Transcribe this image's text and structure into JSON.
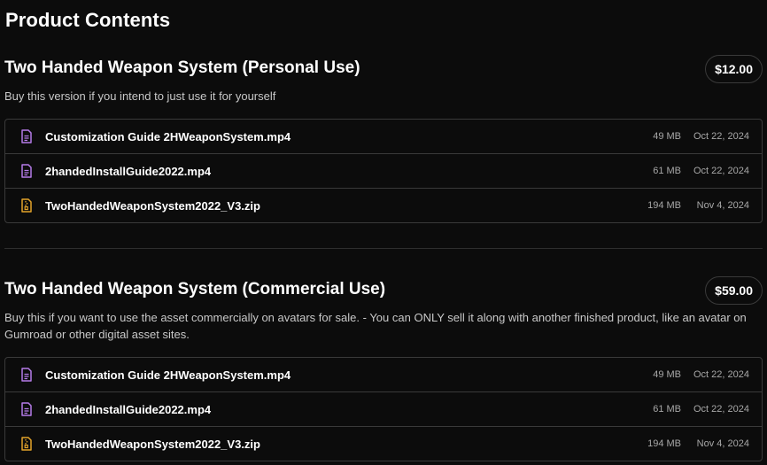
{
  "page_title": "Product Contents",
  "colors": {
    "background": "#0c0c0c",
    "border": "#3a3a3a",
    "video_icon": "#b57be8",
    "zip_icon": "#e3a32a",
    "muted_text": "#a8a8a8"
  },
  "sections": [
    {
      "title": "Two Handed Weapon System (Personal Use)",
      "price": "$12.00",
      "description": "Buy this version if you intend to just use it for yourself",
      "files": [
        {
          "name": "Customization Guide 2HWeaponSystem.mp4",
          "size": "49 MB",
          "date": "Oct 22, 2024",
          "icon": "document-icon"
        },
        {
          "name": "2handedInstallGuide2022.mp4",
          "size": "61 MB",
          "date": "Oct 22, 2024",
          "icon": "document-icon"
        },
        {
          "name": "TwoHandedWeaponSystem2022_V3.zip",
          "size": "194 MB",
          "date": "Nov 4, 2024",
          "icon": "zip-file-icon"
        }
      ]
    },
    {
      "title": "Two Handed Weapon System (Commercial Use)",
      "price": "$59.00",
      "description": "Buy this if you want to use the asset commercially on avatars for sale. - You can ONLY sell it along with another finished product, like an avatar on Gumroad or other digital asset sites.",
      "files": [
        {
          "name": "Customization Guide 2HWeaponSystem.mp4",
          "size": "49 MB",
          "date": "Oct 22, 2024",
          "icon": "document-icon"
        },
        {
          "name": "2handedInstallGuide2022.mp4",
          "size": "61 MB",
          "date": "Oct 22, 2024",
          "icon": "document-icon"
        },
        {
          "name": "TwoHandedWeaponSystem2022_V3.zip",
          "size": "194 MB",
          "date": "Nov 4, 2024",
          "icon": "zip-file-icon"
        }
      ]
    }
  ]
}
